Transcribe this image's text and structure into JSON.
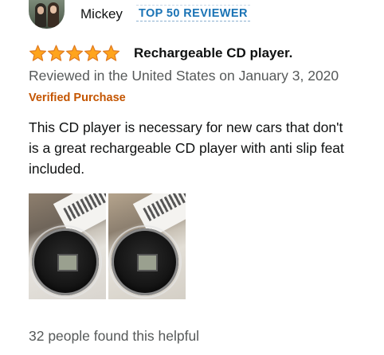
{
  "reviewer": {
    "name": "Mickey",
    "badge": "TOP 50 REVIEWER"
  },
  "review": {
    "rating": 5,
    "rating_max": 5,
    "star_color": "#ffa41c",
    "title": "Rechargeable CD player.",
    "meta": "Reviewed in the United States on January 3, 2020",
    "verified_label": "Verified Purchase",
    "body_lines": [
      "This CD player is necessary for new cars that don't",
      "is a great rechargeable CD player with anti slip feat",
      "included."
    ],
    "image_count": 2,
    "helpful": "32 people found this helpful"
  },
  "colors": {
    "badge": "#1a73b5",
    "verified": "#c45500",
    "secondary_text": "#565959"
  },
  "icons": {
    "star": "star-icon",
    "avatar": "avatar"
  }
}
